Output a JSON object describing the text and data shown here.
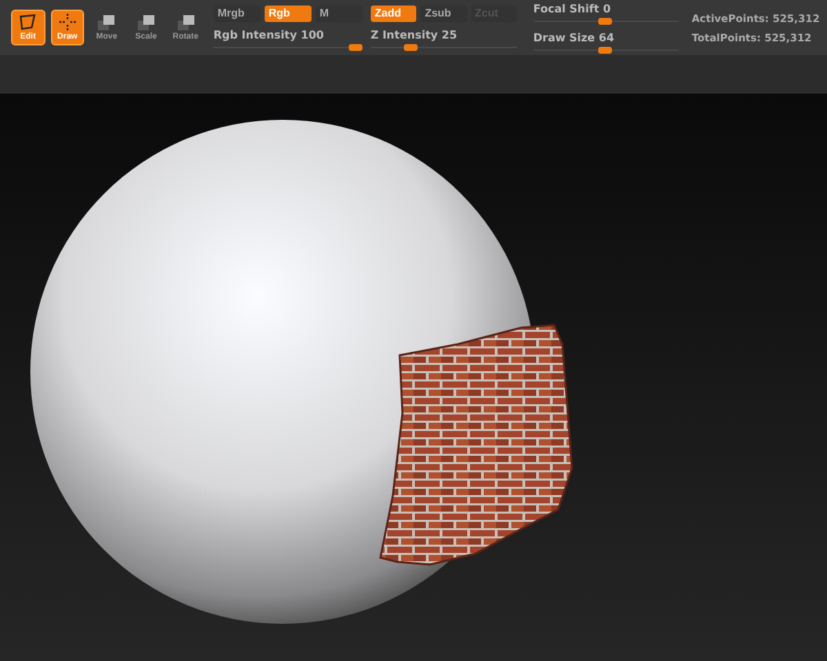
{
  "tools": [
    {
      "label": "Edit",
      "kind": "edit",
      "selected": true
    },
    {
      "label": "Draw",
      "kind": "draw",
      "selected": true
    },
    {
      "label": "Move",
      "kind": "move",
      "selected": false
    },
    {
      "label": "Scale",
      "kind": "scale",
      "selected": false
    },
    {
      "label": "Rotate",
      "kind": "rotate",
      "selected": false
    }
  ],
  "rgb_modes": [
    {
      "label": "Mrgb",
      "selected": false
    },
    {
      "label": "Rgb",
      "selected": true
    },
    {
      "label": "M",
      "selected": false
    }
  ],
  "z_modes": [
    {
      "label": "Zadd",
      "selected": true,
      "disabled": false
    },
    {
      "label": "Zsub",
      "selected": false,
      "disabled": false
    },
    {
      "label": "Zcut",
      "selected": false,
      "disabled": true
    }
  ],
  "sliders": [
    {
      "label": "Rgb Intensity",
      "value": "100",
      "level": 1.0
    },
    {
      "label": "Z Intensity",
      "value": "25",
      "level": 0.25
    },
    {
      "label": "Focal Shift",
      "value": "0",
      "level": 0.5
    },
    {
      "label": "Draw Size",
      "value": "64",
      "level": 0.5
    }
  ],
  "stats": [
    {
      "label": "ActivePoints:",
      "value": "525,312"
    },
    {
      "label": "TotalPoints:",
      "value": "525,312"
    }
  ]
}
